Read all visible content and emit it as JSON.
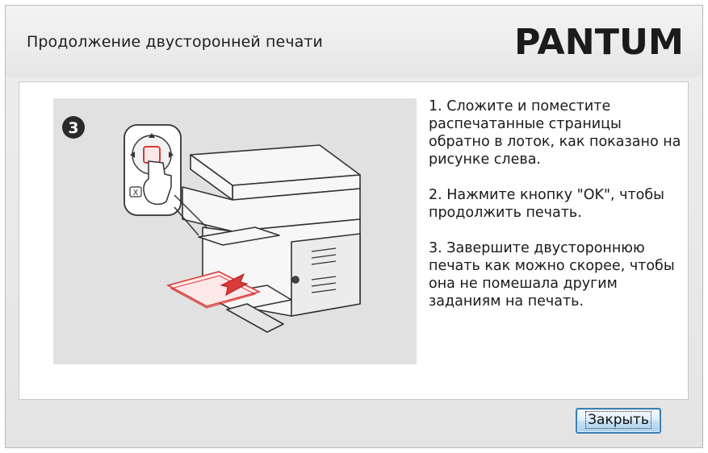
{
  "dialog": {
    "title": "Продолжение двусторонней печати",
    "logo_text": "PANTUM"
  },
  "illustration": {
    "step_number": "3"
  },
  "instructions": [
    "1. Сложите и поместите распечатанные страницы обратно в лоток, как показано на рисунке слева.",
    "2. Нажмите кнопку \"OK\", чтобы продолжить печать.",
    "3. Завершите двустороннюю печать как можно скорее, чтобы она не помешала другим заданиям на печать."
  ],
  "buttons": {
    "close_label": "Закрыть"
  },
  "colors": {
    "accent_red": "#d93a3a",
    "button_border": "#3c7fb1"
  }
}
